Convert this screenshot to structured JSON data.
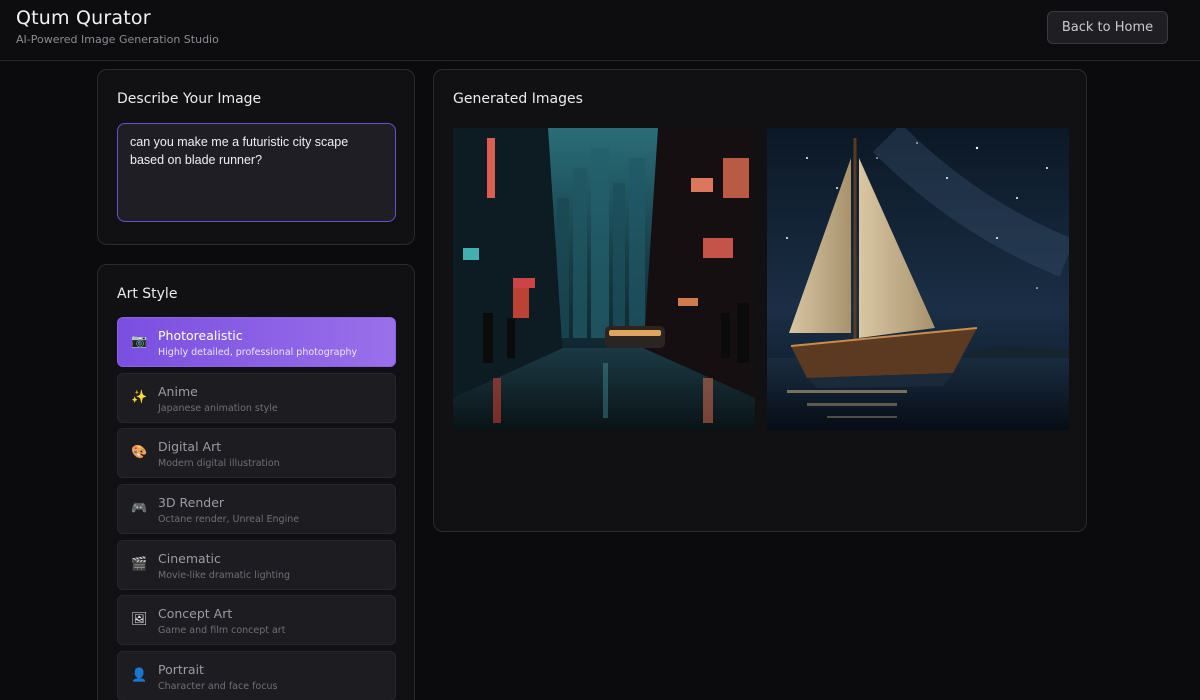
{
  "header": {
    "title": "Qtum Qurator",
    "subtitle": "AI-Powered Image Generation Studio",
    "back_label": "Back to Home"
  },
  "describe": {
    "title": "Describe Your Image",
    "prompt_value": "can you make me a futuristic city scape based on blade runner?"
  },
  "art_style": {
    "title": "Art Style",
    "selected": "Photorealistic",
    "items": [
      {
        "icon": "camera-icon",
        "glyph": "📷",
        "name": "Photorealistic",
        "desc": "Highly detailed, professional photography"
      },
      {
        "icon": "sparkles-icon",
        "glyph": "✨",
        "name": "Anime",
        "desc": "Japanese animation style"
      },
      {
        "icon": "palette-icon",
        "glyph": "🎨",
        "name": "Digital Art",
        "desc": "Modern digital illustration"
      },
      {
        "icon": "gamepad-icon",
        "glyph": "🎮",
        "name": "3D Render",
        "desc": "Octane render, Unreal Engine"
      },
      {
        "icon": "clapperboard-icon",
        "glyph": "🎬",
        "name": "Cinematic",
        "desc": "Movie-like dramatic lighting"
      },
      {
        "icon": "framed-picture-icon",
        "glyph": "🖼",
        "name": "Concept Art",
        "desc": "Game and film concept art"
      },
      {
        "icon": "person-icon",
        "glyph": "👤",
        "name": "Portrait",
        "desc": "Character and face focus"
      }
    ]
  },
  "generated": {
    "title": "Generated Images",
    "images": [
      {
        "subject": "cyberpunk city street at night with neon signs, rain-soaked road and a car"
      },
      {
        "subject": "sailboat on water under a starry night sky"
      }
    ]
  },
  "colors": {
    "background": "#0b0b0e",
    "card": "#111114",
    "accent": "#7a4fe0",
    "accent_light": "#9a70ea",
    "input_border": "#6a4fd0"
  }
}
